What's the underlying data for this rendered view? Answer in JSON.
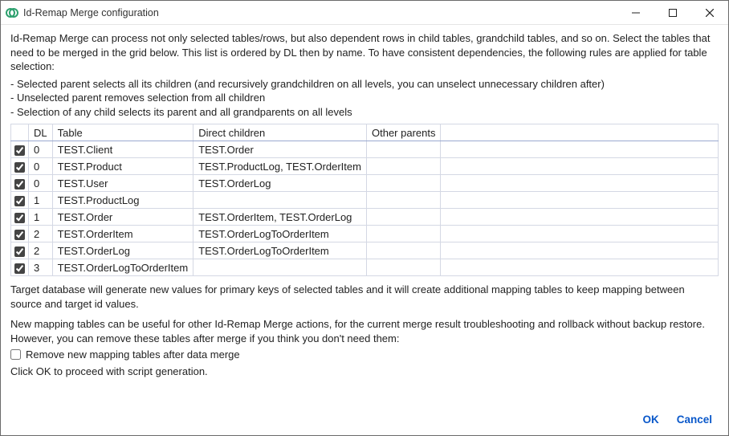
{
  "window": {
    "title": "Id-Remap Merge configuration"
  },
  "intro": "Id-Remap Merge can process not only selected tables/rows, but also dependent rows in child tables, grandchild tables, and so on. Select the tables that need to be merged in the grid below. This list is ordered by DL then by name. To have consistent dependencies, the following rules are applied for table selection:",
  "rules": {
    "r1": "- Selected parent selects all its children (and recursively grandchildren on all levels, you can unselect unnecessary children after)",
    "r2": "- Unselected parent removes selection from all children",
    "r3": "- Selection of any child selects its parent and all grandparents on all levels"
  },
  "grid": {
    "headers": {
      "chk": "",
      "dl": "DL",
      "table": "Table",
      "direct": "Direct children",
      "other": "Other parents"
    },
    "rows": [
      {
        "checked": true,
        "dl": "0",
        "table": "TEST.Client",
        "direct": "TEST.Order",
        "other": ""
      },
      {
        "checked": true,
        "dl": "0",
        "table": "TEST.Product",
        "direct": "TEST.ProductLog, TEST.OrderItem",
        "other": ""
      },
      {
        "checked": true,
        "dl": "0",
        "table": "TEST.User",
        "direct": "TEST.OrderLog",
        "other": ""
      },
      {
        "checked": true,
        "dl": "1",
        "table": "TEST.ProductLog",
        "direct": "",
        "other": ""
      },
      {
        "checked": true,
        "dl": "1",
        "table": "TEST.Order",
        "direct": "TEST.OrderItem, TEST.OrderLog",
        "other": ""
      },
      {
        "checked": true,
        "dl": "2",
        "table": "TEST.OrderItem",
        "direct": "TEST.OrderLogToOrderItem",
        "other": ""
      },
      {
        "checked": true,
        "dl": "2",
        "table": "TEST.OrderLog",
        "direct": "TEST.OrderLogToOrderItem",
        "other": ""
      },
      {
        "checked": true,
        "dl": "3",
        "table": "TEST.OrderLogToOrderItem",
        "direct": "",
        "other": ""
      }
    ]
  },
  "post1": "Target database will generate new values for primary keys of selected tables and it will create additional mapping tables to keep mapping between source and target id values.",
  "post2": "New mapping tables can be useful for other Id-Remap Merge actions, for the current merge result troubleshooting and rollback without backup restore. However, you can remove these tables after merge if you think you don't need them:",
  "option": {
    "label": "Remove new mapping tables after data merge",
    "checked": false
  },
  "post3": "Click OK to proceed with script generation.",
  "footer": {
    "ok": "OK",
    "cancel": "Cancel"
  }
}
